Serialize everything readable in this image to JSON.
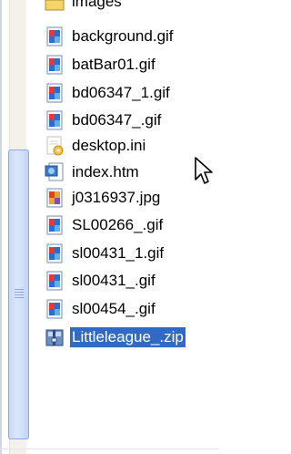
{
  "files": [
    {
      "name": "images",
      "icon": "folder-icon",
      "selected": false
    },
    {
      "name": "background.gif",
      "icon": "gif-file-icon",
      "selected": false
    },
    {
      "name": "batBar01.gif",
      "icon": "gif-file-icon",
      "selected": false
    },
    {
      "name": "bd06347_1.gif",
      "icon": "gif-file-icon",
      "selected": false
    },
    {
      "name": "bd06347_.gif",
      "icon": "gif-file-icon",
      "selected": false
    },
    {
      "name": "desktop.ini",
      "icon": "settings-file-icon",
      "selected": false
    },
    {
      "name": "index.htm",
      "icon": "html-file-icon",
      "selected": false
    },
    {
      "name": "j0316937.jpg",
      "icon": "jpg-file-icon",
      "selected": false
    },
    {
      "name": "SL00266_.gif",
      "icon": "gif-file-icon",
      "selected": false
    },
    {
      "name": "sl00431_1.gif",
      "icon": "gif-file-icon",
      "selected": false
    },
    {
      "name": "sl00431_.gif",
      "icon": "gif-file-icon",
      "selected": false
    },
    {
      "name": "sl00454_.gif",
      "icon": "gif-file-icon",
      "selected": false
    },
    {
      "name": "Littleleague_.zip",
      "icon": "zip-file-icon",
      "selected": true
    }
  ],
  "colors": {
    "selection": "#316ac5",
    "scrollbar_thumb": "#c8d8f8"
  }
}
